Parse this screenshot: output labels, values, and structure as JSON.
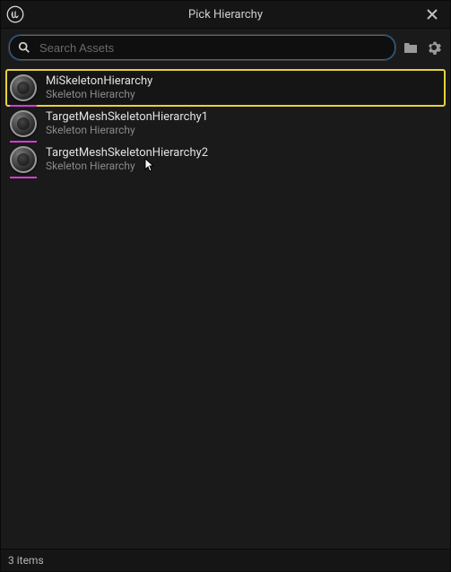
{
  "window": {
    "title": "Pick Hierarchy"
  },
  "search": {
    "placeholder": "Search Assets",
    "value": ""
  },
  "assets": [
    {
      "name": "MiSkeletonHierarchy",
      "type": "Skeleton Hierarchy",
      "accent": "#d63bd6",
      "selected": true
    },
    {
      "name": "TargetMeshSkeletonHierarchy1",
      "type": "Skeleton Hierarchy",
      "accent": "#d63bd6",
      "selected": false
    },
    {
      "name": "TargetMeshSkeletonHierarchy2",
      "type": "Skeleton Hierarchy",
      "accent": "#d63bd6",
      "selected": false,
      "cursor": true
    }
  ],
  "footer": {
    "count_text": "3 items"
  }
}
